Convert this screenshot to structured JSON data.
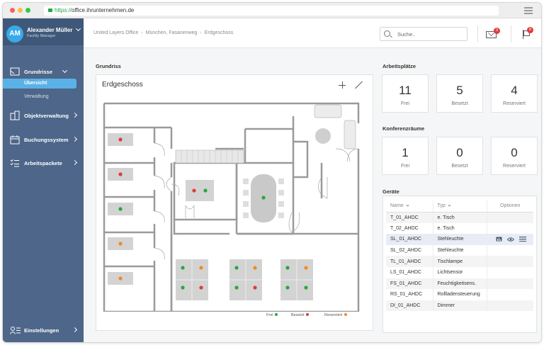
{
  "browser": {
    "url_scheme": "https://",
    "url_host": "office.ihrunternehmen.de"
  },
  "user": {
    "initials": "AM",
    "name": "Alexander Müller",
    "role": "Facility Manager"
  },
  "sidebar": {
    "items": [
      {
        "label": "Grundrisse",
        "icon": "floorplan-icon"
      },
      {
        "label": "Objektverwaltung",
        "icon": "buildings-icon"
      },
      {
        "label": "Buchungssystem",
        "icon": "calendar-icon"
      },
      {
        "label": "Arbeitspackete",
        "icon": "checklist-icon"
      }
    ],
    "subitems": [
      "Übersicht",
      "Verwaltung"
    ],
    "settings": "Einstellungen"
  },
  "breadcrumb": [
    "United Layers Office",
    "München, Fasanenweg",
    "Erdgeschoss"
  ],
  "search": {
    "placeholder": "Suche.."
  },
  "notifications": {
    "mail": "3",
    "flag": "8"
  },
  "floorplan": {
    "section": "Grundriss",
    "title": "Erdgeschoss",
    "legend": [
      {
        "label": "Frei",
        "color": "#25a93a"
      },
      {
        "label": "Besetzt",
        "color": "#e03b3b"
      },
      {
        "label": "Reserviert",
        "color": "#f08a24"
      }
    ]
  },
  "workplaces": {
    "title": "Arbeitsplätze",
    "stats": [
      {
        "value": "11",
        "label": "Frei"
      },
      {
        "value": "5",
        "label": "Besetzt"
      },
      {
        "value": "4",
        "label": "Reserviert"
      }
    ]
  },
  "rooms": {
    "title": "Konferenzräume",
    "stats": [
      {
        "value": "1",
        "label": "Frei"
      },
      {
        "value": "0",
        "label": "Besetzt"
      },
      {
        "value": "0",
        "label": "Reserviert"
      }
    ]
  },
  "devices": {
    "title": "Geräte",
    "headers": [
      "Name",
      "Typ",
      "Optionen"
    ],
    "rows": [
      {
        "name": "T_01_AHDC",
        "type": "e. Tisch"
      },
      {
        "name": "T_02_AHDC",
        "type": "e. Tisch"
      },
      {
        "name": "SL_01_AHDC",
        "type": "Stehleuchte"
      },
      {
        "name": "SL_02_AHDC",
        "type": "Stehleuchte"
      },
      {
        "name": "TL_01_AHDC",
        "type": "Tischlampe"
      },
      {
        "name": "LS_01_AHDC",
        "type": "Lichtsensor"
      },
      {
        "name": "FS_01_AHDC",
        "type": "Feuchtigkeitsens."
      },
      {
        "name": "RS_01_AHDC",
        "type": "Rollladensteuerung"
      },
      {
        "name": "DI_01_AHDC",
        "type": "Dimmer"
      }
    ]
  }
}
